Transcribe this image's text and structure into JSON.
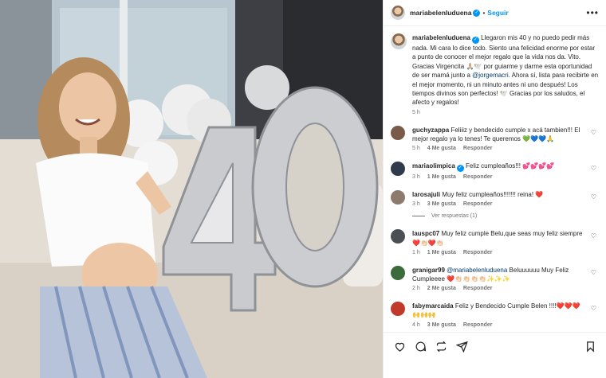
{
  "post": {
    "username": "mariabelenluduena",
    "follow_label": "Seguir",
    "more_label": "•••",
    "caption_username": "mariabelenluduena",
    "caption_part1": "Llegaron mis 40 y no puedo pedir más nada. Mi cara lo dice todo. Siento una felicidad enorme por estar a punto de conocer el mejor regalo que la vida nos da. Vito. Gracias Virgencita 🙏🏼🕊️ por guiarme y darme esta oportunidad de ser mamá junto a ",
    "caption_mention": "@jorgemacri",
    "caption_part2": ". Ahora sí, lista para recibirte en el mejor momento, ni un minuto antes ni uno después! Los tiempos divinos son perfectos! 🕊️ Gracias por los saludos, el afecto y regalos!",
    "caption_time": "5 h"
  },
  "comments": [
    {
      "username": "guchyzappa",
      "text": "Feliiiz y bendecido cumple x acá tambien!!! El mejor regalo ya lo tenes! Te queremos 💚💙💙🙏",
      "time": "5 h",
      "likes": "4 Me gusta",
      "reply": "Responder",
      "avatar_color": "#7a5a48"
    },
    {
      "username": "mariaolimpica",
      "verified": true,
      "text": "Feliz cumpleaños!!! 💕💕💕💕",
      "time": "3 h",
      "likes": "1 Me gusta",
      "reply": "Responder",
      "avatar_color": "#2f3a4a"
    },
    {
      "username": "larosajuli",
      "text": "Muy feliz cumpleaños!!!!!!! reina! ❤️",
      "time": "3 h",
      "likes": "3 Me gusta",
      "reply": "Responder",
      "avatar_color": "#8c7a6d",
      "view_replies": "Ver respuestas (1)"
    },
    {
      "username": "lauspc07",
      "text": "Muy feliz cumple Belu,que seas muy feliz siempre ❤️👏🏻❤️👏🏻",
      "time": "1 h",
      "likes": "1 Me gusta",
      "reply": "Responder",
      "avatar_color": "#4a4f55"
    },
    {
      "username": "granigar99",
      "mention": "@mariabelenluduena",
      "text": " Beluuuuuu Muy Feliz Cumpleeee ❤️👏🏻👏🏻👏🏻👏🏻✨✨✨",
      "time": "2 h",
      "likes": "2 Me gusta",
      "reply": "Responder",
      "avatar_color": "#3b6b3a"
    },
    {
      "username": "fabymarcaida",
      "text": "Feliz y Bendecido Cumple Belen !!!!❤️❤️❤️🙌🙌🙌",
      "time": "4 h",
      "likes": "3 Me gusta",
      "reply": "Responder",
      "avatar_color": "#c0392b"
    }
  ],
  "actions": {
    "like_icon": "heart-icon",
    "comment_icon": "comment-icon",
    "share_icon": "repost-icon",
    "send_icon": "send-icon",
    "save_icon": "bookmark-icon"
  },
  "colors": {
    "accent": "#0095f6",
    "mention": "#00376b",
    "muted": "#737373",
    "text": "#262626"
  }
}
